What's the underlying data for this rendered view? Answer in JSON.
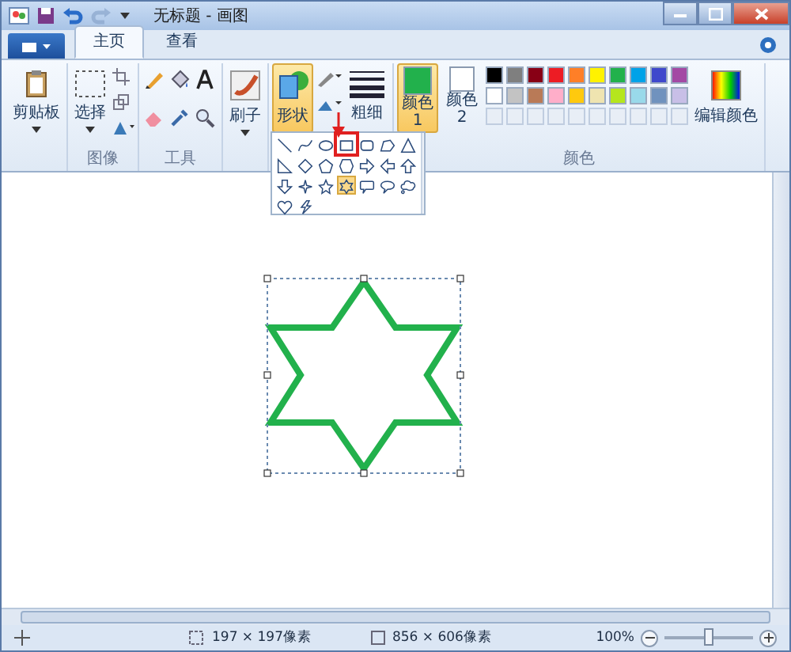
{
  "window": {
    "title": "无标题 - 画图"
  },
  "tabs": [
    {
      "label": "主页",
      "selected": true
    },
    {
      "label": "查看",
      "selected": false
    }
  ],
  "ribbon": {
    "clipboard": "剪贴板",
    "select": "选择",
    "image_group": "图像",
    "tools_group": "工具",
    "brushes": "刷子",
    "shapes": "形状",
    "thickness": "粗细",
    "color1": {
      "label": "颜色 1",
      "selected": true,
      "color": "#22b14c"
    },
    "color2": {
      "label": "颜色 2",
      "selected": false,
      "color": "#ffffff"
    },
    "colors_group": "颜色",
    "edit_colors": "编辑颜色"
  },
  "palette": [
    {
      "color": "#000000"
    },
    {
      "color": "#7f7f7f"
    },
    {
      "color": "#880015"
    },
    {
      "color": "#ed1c24"
    },
    {
      "color": "#ff7f27"
    },
    {
      "color": "#fff200"
    },
    {
      "color": "#22b14c"
    },
    {
      "color": "#00a2e8"
    },
    {
      "color": "#3f48cc"
    },
    {
      "color": "#a349a4"
    },
    {
      "color": "#ffffff"
    },
    {
      "color": "#c3c3c3"
    },
    {
      "color": "#b97a57"
    },
    {
      "color": "#ffaec9"
    },
    {
      "color": "#ffc90e"
    },
    {
      "color": "#efe4b0"
    },
    {
      "color": "#b5e61d"
    },
    {
      "color": "#99d9ea"
    },
    {
      "color": "#7092be"
    },
    {
      "color": "#c8bfe7"
    }
  ],
  "shape_gallery": [
    {
      "kind": "line",
      "selected": false
    },
    {
      "kind": "curve",
      "selected": false
    },
    {
      "kind": "oval",
      "selected": false
    },
    {
      "kind": "rectangle",
      "selected": false,
      "highlighted": true
    },
    {
      "kind": "rounded-rectangle",
      "selected": false
    },
    {
      "kind": "polygon",
      "selected": false
    },
    {
      "kind": "triangle",
      "selected": false
    },
    {
      "kind": "right-triangle",
      "selected": false
    },
    {
      "kind": "diamond",
      "selected": false
    },
    {
      "kind": "pentagon",
      "selected": false
    },
    {
      "kind": "hexagon",
      "selected": false
    },
    {
      "kind": "right-arrow",
      "selected": false
    },
    {
      "kind": "left-arrow",
      "selected": false
    },
    {
      "kind": "up-arrow",
      "selected": false
    },
    {
      "kind": "down-arrow",
      "selected": false
    },
    {
      "kind": "four-point-star",
      "selected": false
    },
    {
      "kind": "five-point-star",
      "selected": false
    },
    {
      "kind": "six-point-star",
      "selected": true
    },
    {
      "kind": "rect-callout",
      "selected": false
    },
    {
      "kind": "oval-callout",
      "selected": false
    },
    {
      "kind": "cloud-callout",
      "selected": false
    },
    {
      "kind": "heart",
      "selected": false
    },
    {
      "kind": "lightning",
      "selected": false
    }
  ],
  "status_bar": {
    "selection_size": "197 × 197像素",
    "image_size": "856 × 606像素",
    "zoom": "100%",
    "zoom_level": {
      "level": 0.5
    }
  }
}
